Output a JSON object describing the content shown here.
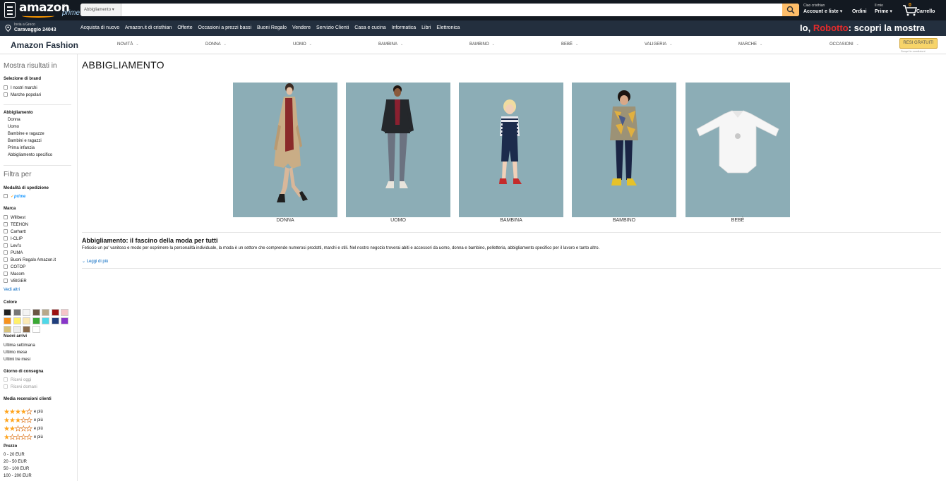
{
  "header": {
    "logo_text": "amazon",
    "logo_tld": ".it",
    "logo_prime": "prime",
    "search_category": "Abbigliamento ▾",
    "search_value": "",
    "greeting": "Ciao cristhian",
    "account_label": "Account e liste ▾",
    "orders_label": "Ordini",
    "prime_small": "Il mio",
    "prime_label": "Prime ▾",
    "cart_count": "0",
    "cart_label": "Carrello"
  },
  "subnav": {
    "deliver_line1": "Invia a Greco",
    "deliver_line2": "Caravaggio 24043",
    "links": [
      "Acquista di nuovo",
      "Amazon.it di cristhian",
      "Offerte",
      "Occasioni a prezzi bassi",
      "Buoni Regalo",
      "Vendere",
      "Servizio Clienti",
      "Casa e cucina",
      "Informatica",
      "Libri",
      "Elettronica"
    ],
    "promo_prefix": "Io, ",
    "promo_brand": "Robotto",
    "promo_suffix": ": scopri la mostra"
  },
  "fashion_nav": {
    "brand": "Amazon Fashion",
    "items": [
      "NOVITÀ",
      "DONNA",
      "UOMO",
      "BAMBINA",
      "BAMBINO",
      "BEBÈ",
      "VALIGERIA",
      "MARCHE",
      "OCCASIONI"
    ],
    "resi_button": "RESI GRATUITI",
    "resi_note": "Scopri le condizioni"
  },
  "sidebar": {
    "mostra": "Mostra risultati in",
    "brand_section": {
      "title": "Selezione di brand",
      "options": [
        "I nostri marchi",
        "Marche popolari"
      ]
    },
    "abbigliamento": {
      "title": "Abbigliamento",
      "items": [
        "Donna",
        "Uomo",
        "Bambine e ragazze",
        "Bambini e ragazzi",
        "Prima infanzia",
        "Abbigliamento specifico"
      ]
    },
    "filtra": "Filtra per",
    "spedizione": {
      "title": "Modalità di spedizione",
      "prime": "prime"
    },
    "marca": {
      "title": "Marca",
      "options": [
        "Willbest",
        "TEEHON",
        "Carhartt",
        "I-CLIP",
        "Levi's",
        "PUMA",
        "Buoni Regalo Amazon.it",
        "COTOP",
        "Macom",
        "VBIGER"
      ],
      "more": "Vedi altri"
    },
    "colore": {
      "title": "Colore",
      "swatches": [
        "#222222",
        "#777777",
        "#f4f4f4",
        "#6b5544",
        "#b8a88a",
        "#9c1111",
        "#f5c5c8",
        "#f7931e",
        "#fff06a",
        "#fbe9b4",
        "#3aa835",
        "#4fd8e8",
        "#203e7c",
        "#8836c9",
        "#d8c27a",
        "#eeeeee",
        "#8a6a4a",
        "#ffffff"
      ]
    },
    "nuovi_arrivi": {
      "title": "Nuovi arrivi",
      "items": [
        "Ultima settimana",
        "Ultimo mese",
        "Ultimi tre mesi"
      ]
    },
    "consegna": {
      "title": "Giorno di consegna",
      "options": [
        "Ricevi oggi",
        "Ricevi domani"
      ]
    },
    "recensioni": {
      "title": "Media recensioni clienti",
      "rows": [
        4,
        3,
        2,
        1
      ],
      "suffix": "e più"
    },
    "prezzo": {
      "title": "Prezzo",
      "items": [
        "0 - 20 EUR",
        "20 - 50 EUR",
        "50 - 100 EUR",
        "100 - 200 EUR"
      ]
    }
  },
  "main": {
    "title": "ABBIGLIAMENTO",
    "categories": [
      "DONNA",
      "UOMO",
      "BAMBINA",
      "BAMBINO",
      "BEBÈ"
    ],
    "section_heading": "Abbigliamento: il fascino della moda per tutti",
    "section_text": "Feticcio un po' vanitoso e modo per esprimere la personalità individuale, la moda è un settore che comprende numerosi prodotti, marchi e stili. Nel nostro negozio troverai abiti e accessori da uomo, donna e bambino, pelletteria, abbigliamento specifico per il lavoro e tanto altro.",
    "read_more": "Leggi di più"
  },
  "colors": {
    "nav_dark": "#131921",
    "nav_sub": "#232f3e",
    "accent": "#febd69",
    "link": "#0066c0",
    "star": "#ffa41c",
    "photo_bg": "#8cadb6"
  }
}
